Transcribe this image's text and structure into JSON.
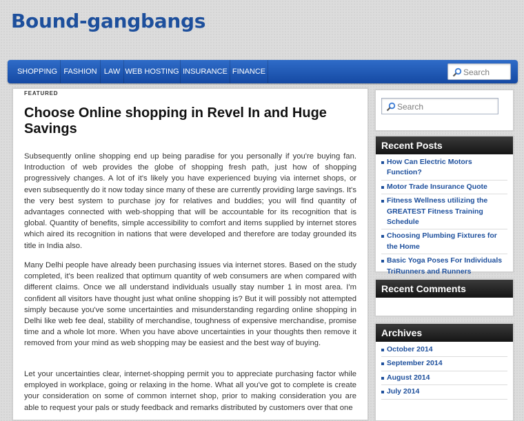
{
  "site": {
    "title": "Bound-gangbangs"
  },
  "nav": {
    "items": [
      "SHOPPING",
      "FASHION",
      "LAW",
      "WEB HOSTING",
      "INSURANCE",
      "FINANCE"
    ],
    "search_placeholder": "Search"
  },
  "post": {
    "category": "FEATURED",
    "title": "Choose Online shopping in Revel In and Huge Savings",
    "paragraphs": [
      "Subsequently online shopping end up being paradise for you personally if you're buying fan. Introduction of web provides the globe of shopping fresh path, just how of shopping progressively changes. A lot of it's likely you have experienced buying via internet shops, or even subsequently do it now today since many of these are currently providing large savings. It's the very best system to purchase joy for relatives and buddies; you will find quantity of advantages connected with web-shopping that will be accountable for its recognition that is global. Quantity of benefits, simple accessibility to comfort and items supplied by internet stores which aired its recognition in nations that were developed and therefore are today grounded its title in India also.",
      "Many Delhi people have already been purchasing issues via internet stores. Based on the study completed, it's been realized that optimum quantity of web consumers are when compared with different claims. Once we all understand individuals usually stay number 1 in most area. I'm confident all visitors have thought just what online shopping is? But it will possibly not attempted simply because you've some uncertainties and misunderstanding regarding online shopping in Delhi like web fee deal, stability of merchandise, toughness of expensive merchandise, promise time and a whole lot more. When you have above uncertainties in your thoughts then remove it removed from your mind as web shopping may be easiest and the best way of buying.",
      "Let your uncertainties clear, internet-shopping permit you to appreciate purchasing factor while employed in workplace, going or relaxing in the home. What all you've got to complete is create your consideration on some of common internet shop, prior to making consideration you are able to request your pals or study feedback and remarks distributed by customers over that one"
    ]
  },
  "sidebar": {
    "search_placeholder": "Search",
    "recent_posts": {
      "title": "Recent Posts",
      "items": [
        "How Can Electric Motors Function?",
        "Motor Trade Insurance Quote",
        "Fitness Wellness utilizing the GREATEST Fitness Training Schedule",
        "Choosing Plumbing Fixtures for the Home",
        "Basic Yoga Poses For Individuals TriRunners and Runners"
      ]
    },
    "recent_comments": {
      "title": "Recent Comments"
    },
    "archives": {
      "title": "Archives",
      "items": [
        "October 2014",
        "September 2014",
        "August 2014",
        "July 2014"
      ]
    }
  },
  "colors": {
    "accent": "#1d4f9c",
    "nav": "#1f5cb8",
    "widget_header": "#222222"
  },
  "icons": {
    "search": "magnifier-icon"
  }
}
